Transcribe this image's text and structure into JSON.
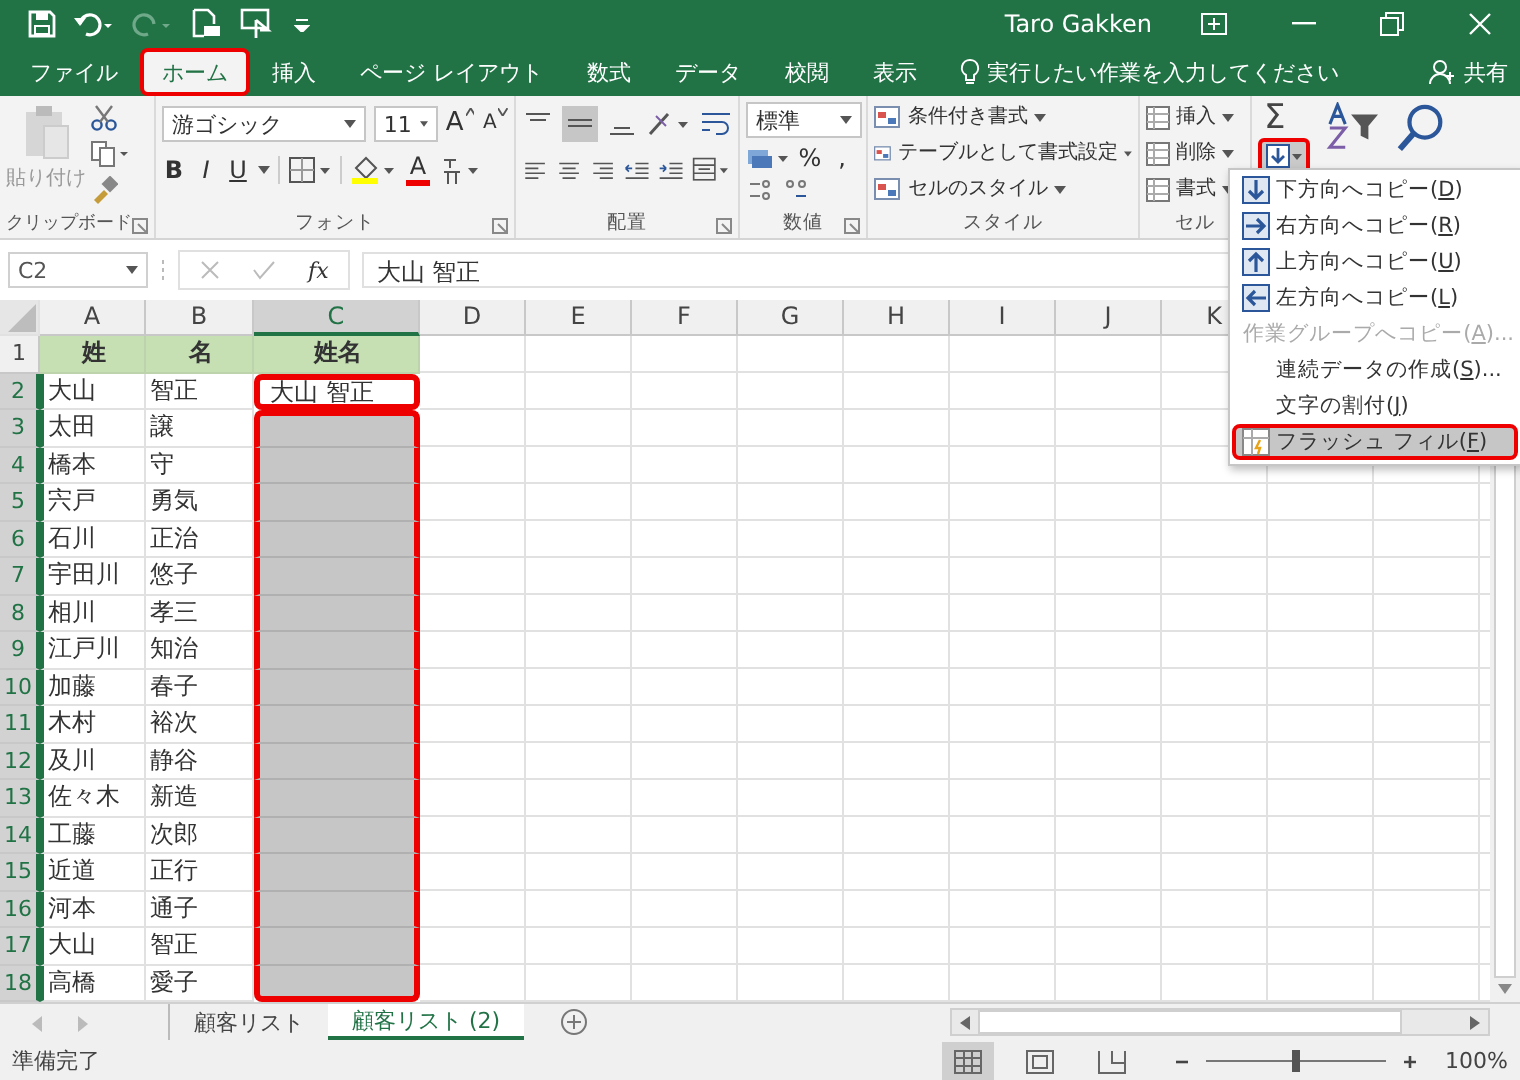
{
  "title_bar": {
    "user": "Taro Gakken"
  },
  "tabs": [
    {
      "label": "ファイル",
      "selected": false,
      "highlighted": false
    },
    {
      "label": "ホーム",
      "selected": true,
      "highlighted": true
    },
    {
      "label": "挿入",
      "selected": false,
      "highlighted": false
    },
    {
      "label": "ページ レイアウト",
      "selected": false,
      "highlighted": false
    },
    {
      "label": "数式",
      "selected": false,
      "highlighted": false
    },
    {
      "label": "データ",
      "selected": false,
      "highlighted": false
    },
    {
      "label": "校閲",
      "selected": false,
      "highlighted": false
    },
    {
      "label": "表示",
      "selected": false,
      "highlighted": false
    }
  ],
  "tell_me": {
    "placeholder": "実行したい作業を入力してください"
  },
  "share": "共有",
  "ribbon": {
    "clipboard": {
      "paste": "貼り付け",
      "label": "クリップボード"
    },
    "font": {
      "name": "游ゴシック",
      "size": "11",
      "grow": "A",
      "shrink": "A",
      "bold": "B",
      "italic": "I",
      "underline": "U",
      "color_button": "A",
      "label": "フォント"
    },
    "alignment": {
      "label": "配置"
    },
    "number": {
      "format": "標準",
      "percent": "%",
      "comma": ",",
      "label": "数値"
    },
    "styles": {
      "items": [
        "条件付き書式",
        "テーブルとして書式設定",
        "セルのスタイル"
      ],
      "label": "スタイル"
    },
    "cells": {
      "items": [
        "挿入",
        "削除",
        "書式"
      ],
      "label": "セル"
    },
    "editing": {
      "autosum": "Σ",
      "fill_highlighted": true
    }
  },
  "formula_bar": {
    "name_box": "C2",
    "function": "fx",
    "value": "大山 智正"
  },
  "columns": [
    {
      "label": "A",
      "selected": false
    },
    {
      "label": "B",
      "selected": false
    },
    {
      "label": "C",
      "selected": true
    },
    {
      "label": "D",
      "selected": false
    },
    {
      "label": "E",
      "selected": false
    },
    {
      "label": "F",
      "selected": false
    },
    {
      "label": "G",
      "selected": false
    },
    {
      "label": "H",
      "selected": false
    },
    {
      "label": "I",
      "selected": false
    },
    {
      "label": "J",
      "selected": false
    },
    {
      "label": "K",
      "selected": false
    }
  ],
  "rows": [
    {
      "number": "1",
      "kind": "header",
      "selected": false,
      "cells": [
        "姓",
        "名",
        "姓名"
      ]
    },
    {
      "number": "2",
      "kind": "data",
      "selected": true,
      "cells": [
        "大山",
        "智正",
        "大山 智正"
      ],
      "c_selected": false,
      "c_highlighted": true,
      "c_box_start": true
    },
    {
      "number": "3",
      "kind": "data",
      "selected": true,
      "cells": [
        "太田",
        "譲"
      ],
      "c_selected": true,
      "c_highlighted": true,
      "c_box_start": true
    },
    {
      "number": "4",
      "kind": "data",
      "selected": true,
      "cells": [
        "橋本",
        "守"
      ],
      "c_selected": true,
      "c_highlighted": true,
      "c_box_start": false
    },
    {
      "number": "5",
      "kind": "data",
      "selected": true,
      "cells": [
        "宍戸",
        "勇気"
      ],
      "c_selected": true,
      "c_highlighted": true,
      "c_box_start": false
    },
    {
      "number": "6",
      "kind": "data",
      "selected": true,
      "cells": [
        "石川",
        "正治"
      ],
      "c_selected": true,
      "c_highlighted": true,
      "c_box_start": false
    },
    {
      "number": "7",
      "kind": "data",
      "selected": true,
      "cells": [
        "宇田川",
        "悠子"
      ],
      "c_selected": true,
      "c_highlighted": true,
      "c_box_start": false
    },
    {
      "number": "8",
      "kind": "data",
      "selected": true,
      "cells": [
        "相川",
        "孝三"
      ],
      "c_selected": true,
      "c_highlighted": true,
      "c_box_start": false
    },
    {
      "number": "9",
      "kind": "data",
      "selected": true,
      "cells": [
        "江戸川",
        "知治"
      ],
      "c_selected": true,
      "c_highlighted": true,
      "c_box_start": false
    },
    {
      "number": "10",
      "kind": "data",
      "selected": true,
      "cells": [
        "加藤",
        "春子"
      ],
      "c_selected": true,
      "c_highlighted": true,
      "c_box_start": false
    },
    {
      "number": "11",
      "kind": "data",
      "selected": true,
      "cells": [
        "木村",
        "裕次"
      ],
      "c_selected": true,
      "c_highlighted": true,
      "c_box_start": false
    },
    {
      "number": "12",
      "kind": "data",
      "selected": true,
      "cells": [
        "及川",
        "静谷"
      ],
      "c_selected": true,
      "c_highlighted": true,
      "c_box_start": false
    },
    {
      "number": "13",
      "kind": "data",
      "selected": true,
      "cells": [
        "佐々木",
        "新造"
      ],
      "c_selected": true,
      "c_highlighted": true,
      "c_box_start": false
    },
    {
      "number": "14",
      "kind": "data",
      "selected": true,
      "cells": [
        "工藤",
        "次郎"
      ],
      "c_selected": true,
      "c_highlighted": true,
      "c_box_start": false
    },
    {
      "number": "15",
      "kind": "data",
      "selected": true,
      "cells": [
        "近道",
        "正行"
      ],
      "c_selected": true,
      "c_highlighted": true,
      "c_box_start": false
    },
    {
      "number": "16",
      "kind": "data",
      "selected": true,
      "cells": [
        "河本",
        "通子"
      ],
      "c_selected": true,
      "c_highlighted": true,
      "c_box_start": false
    },
    {
      "number": "17",
      "kind": "data",
      "selected": true,
      "cells": [
        "大山",
        "智正"
      ],
      "c_selected": true,
      "c_highlighted": true,
      "c_box_start": false
    },
    {
      "number": "18",
      "kind": "data",
      "selected": true,
      "cells": [
        "高橋",
        "愛子"
      ],
      "c_selected": true,
      "c_highlighted": true,
      "c_box_start": false
    }
  ],
  "fill_menu": [
    {
      "kind": "down",
      "text": "下方向へコピー(",
      "key": "D",
      "after": ")",
      "disabled": false,
      "selected": false,
      "highlighted": false
    },
    {
      "kind": "right",
      "text": "右方向へコピー(",
      "key": "R",
      "after": ")",
      "disabled": false,
      "selected": false,
      "highlighted": false
    },
    {
      "kind": "up",
      "text": "上方向へコピー(",
      "key": "U",
      "after": ")",
      "disabled": false,
      "selected": false,
      "highlighted": false
    },
    {
      "kind": "left",
      "text": "左方向へコピー(",
      "key": "L",
      "after": ")",
      "disabled": false,
      "selected": false,
      "highlighted": false
    },
    {
      "kind": "plain",
      "text": "作業グループへコピー(",
      "key": "A",
      "after": ")...",
      "disabled": true,
      "selected": false,
      "highlighted": false
    },
    {
      "kind": "plain",
      "text": "連続データの作成(",
      "key": "S",
      "after": ")...",
      "disabled": false,
      "selected": false,
      "highlighted": false
    },
    {
      "kind": "plain",
      "text": "文字の割付(",
      "key": "J",
      "after": ")",
      "disabled": false,
      "selected": false,
      "highlighted": false
    },
    {
      "kind": "flash",
      "text": "フラッシュ フィル(",
      "key": "F",
      "after": ")",
      "disabled": false,
      "selected": true,
      "highlighted": true
    }
  ],
  "sheet_tabs": [
    {
      "label": "顧客リスト",
      "selected": false
    },
    {
      "label": "顧客リスト (2)",
      "selected": true
    }
  ],
  "status_bar": {
    "status": "準備完了",
    "views": [
      {
        "kind": "normal",
        "selected": true
      },
      {
        "kind": "page-layout",
        "selected": false
      },
      {
        "kind": "page-break",
        "selected": false
      }
    ],
    "zoom": {
      "level": 0.5
    },
    "zoom_text": "100%"
  }
}
